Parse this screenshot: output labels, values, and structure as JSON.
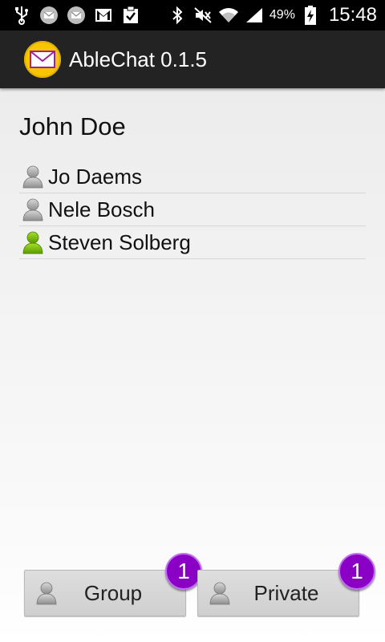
{
  "status_bar": {
    "battery_percent": "49%",
    "time": "15:48",
    "icons": [
      "usb-icon",
      "mail-icon",
      "mail-icon",
      "gmail-icon",
      "clipboard-check-icon",
      "bluetooth-icon",
      "mute-icon",
      "wifi-icon",
      "signal-icon",
      "battery-charging-icon"
    ]
  },
  "action_bar": {
    "app_icon": "envelope-icon",
    "title": "AbleChat 0.1.5"
  },
  "main": {
    "current_user": "John Doe",
    "users": [
      {
        "name": "Jo Daems",
        "status": "offline",
        "icon": "user-gray-icon"
      },
      {
        "name": "Nele Bosch",
        "status": "offline",
        "icon": "user-gray-icon"
      },
      {
        "name": "Steven Solberg",
        "status": "online",
        "icon": "user-green-icon"
      }
    ]
  },
  "buttons": {
    "group_label": "Group",
    "group_badge": "1",
    "private_label": "Private",
    "private_badge": "1"
  },
  "colors": {
    "accent_badge": "#8a00c4",
    "app_icon_bg": "#f7c600",
    "online_user": "#7ab800",
    "offline_user": "#a0a0a0"
  }
}
